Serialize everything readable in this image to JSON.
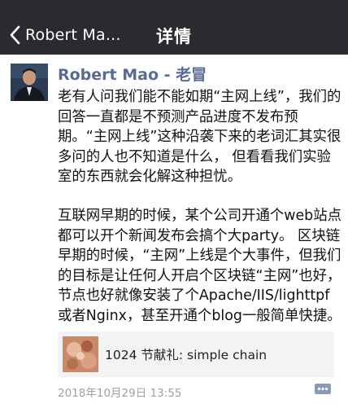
{
  "navbar": {
    "back_label": "Robert Ma...",
    "title": "详情"
  },
  "post": {
    "author": "Robert Mao - 老冒",
    "paragraphs": [
      "老有人问我们能不能如期“主网上线”，我们的回答一直都是不预测产品进度不发布预期。“主网上线”这种沿袭下来的老词汇其实很多问的人也不知道是什么， 但看看我们实验室的东西就会化解这种担忧。",
      "互联网早期的时候，某个公司开通个web站点都可以开个新闻发布会搞个大party。 区块链早期的时候，“主网”上线是个大事件，但我们的目标是让任何人开启个区块链“主网”也好，节点也好就像安装了个Apache/IIS/lighttpf或者Nginx，甚至开通个blog一般简单快捷。"
    ],
    "link_card": {
      "title": "1024 节献礼: simple chain"
    },
    "timestamp": "2018年10月29日 13:55"
  },
  "colors": {
    "navbar_bg": "#2b2b2f",
    "author_link": "#576b95",
    "card_bg": "#f3f3f5",
    "comment_icon": "#8a9bb8"
  },
  "icons": {
    "back": "chevron-left-icon",
    "comment": "comment-icon"
  }
}
